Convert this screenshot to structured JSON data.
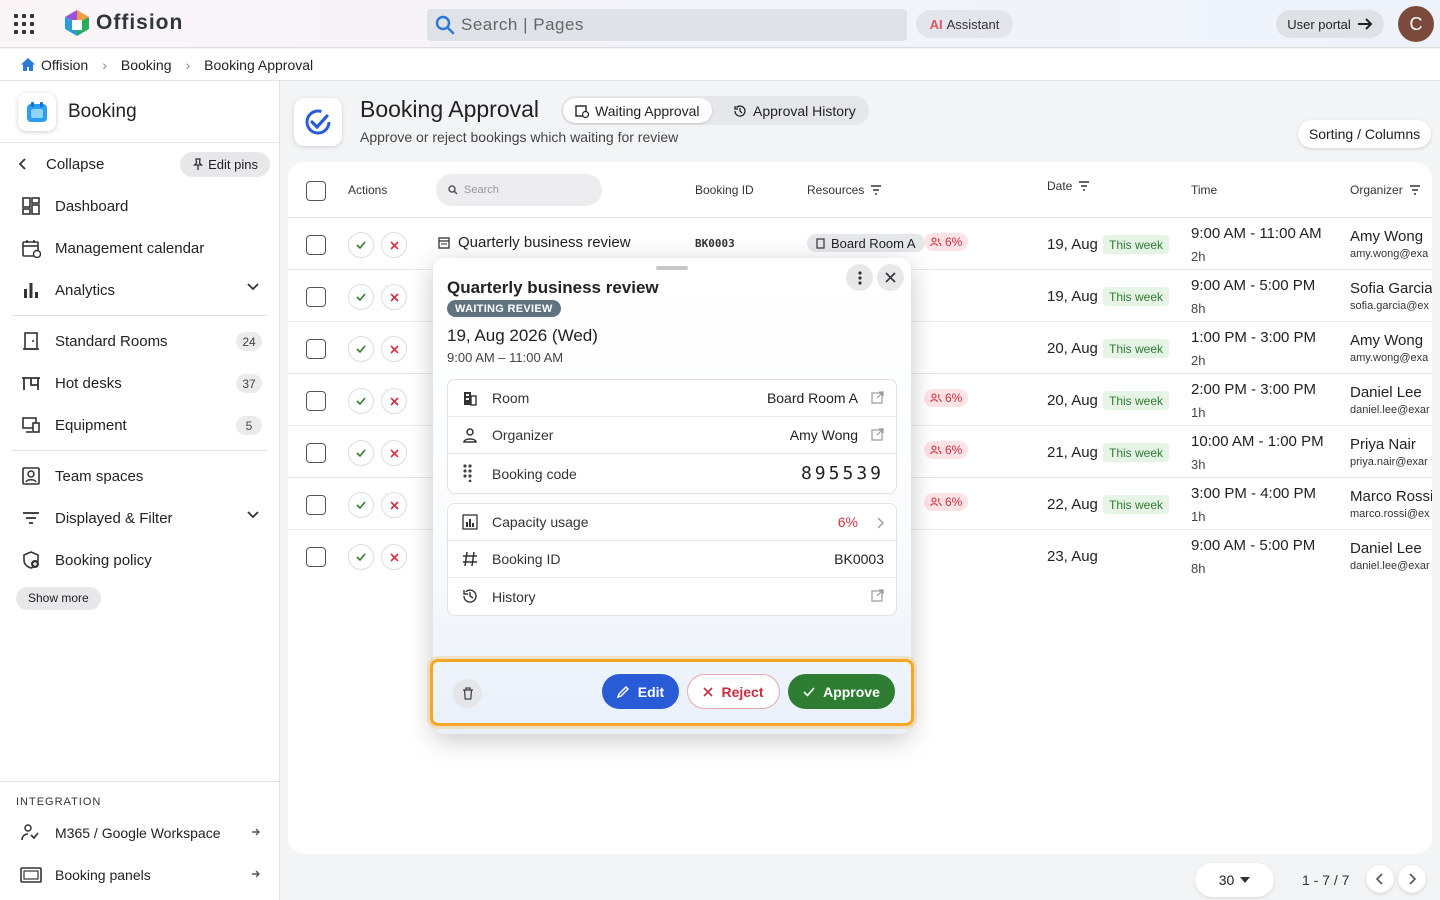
{
  "app": {
    "name": "Offision",
    "search_placeholder": "Search | Pages",
    "ai_badge": "AI",
    "assistant_label": "Assistant",
    "user_portal_label": "User portal",
    "avatar_initial": "C"
  },
  "breadcrumb": [
    "Offision",
    "Booking",
    "Booking Approval"
  ],
  "sidebar": {
    "title": "Booking",
    "collapse_label": "Collapse",
    "edit_pins_label": "Edit pins",
    "items": [
      {
        "label": "Dashboard",
        "icon": "dashboard-icon"
      },
      {
        "label": "Management calendar",
        "icon": "calendar-icon"
      },
      {
        "label": "Analytics",
        "icon": "bar-chart-icon"
      },
      {
        "label": "Standard Rooms",
        "icon": "door-icon",
        "count": "24"
      },
      {
        "label": "Hot desks",
        "icon": "desk-icon",
        "count": "37"
      },
      {
        "label": "Equipment",
        "icon": "monitor-icon",
        "count": "5"
      },
      {
        "label": "Team spaces",
        "icon": "team-icon"
      },
      {
        "label": "Displayed & Filter",
        "icon": "filter-icon"
      },
      {
        "label": "Booking policy",
        "icon": "policy-icon"
      }
    ],
    "show_more_label": "Show more",
    "integration_title": "INTEGRATION",
    "integrations": [
      {
        "label": "M365 / Google Workspace",
        "icon": "workspace-icon"
      },
      {
        "label": "Booking panels",
        "icon": "panel-icon"
      }
    ]
  },
  "page": {
    "title": "Booking Approval",
    "subtitle": "Approve or reject bookings which waiting for review",
    "tabs": [
      {
        "label": "Waiting Approval",
        "active": true
      },
      {
        "label": "Approval History",
        "active": false
      }
    ],
    "sorting_label": "Sorting / Columns"
  },
  "table": {
    "columns": {
      "actions": "Actions",
      "search_placeholder": "Search",
      "booking_id": "Booking ID",
      "resources": "Resources",
      "date": "Date",
      "time": "Time",
      "organizer": "Organizer"
    },
    "rows": [
      {
        "title": "Quarterly business review",
        "booking_id": "BK0003",
        "resource": "Board Room A",
        "capacity": "6%",
        "date": "19, Aug",
        "week": "This week",
        "time": "9:00 AM  -  11:00 AM",
        "duration": "2h",
        "organizer": "Amy Wong",
        "email": "amy.wong@exa"
      },
      {
        "date": "19, Aug",
        "week": "This week",
        "time": "9:00 AM  -  5:00 PM",
        "duration": "8h",
        "organizer": "Sofia Garcia",
        "email": "sofia.garcia@ex"
      },
      {
        "date": "20, Aug",
        "week": "This week",
        "time": "1:00 PM  -  3:00 PM",
        "duration": "2h",
        "organizer": "Amy Wong",
        "email": "amy.wong@exa"
      },
      {
        "capacity": "6%",
        "date": "20, Aug",
        "week": "This week",
        "time": "2:00 PM  -  3:00 PM",
        "duration": "1h",
        "organizer": "Daniel Lee",
        "email": "daniel.lee@exar"
      },
      {
        "capacity": "6%",
        "date": "21, Aug",
        "week": "This week",
        "time": "10:00 AM  -  1:00 PM",
        "duration": "3h",
        "organizer": "Priya Nair",
        "email": "priya.nair@exar"
      },
      {
        "capacity": "6%",
        "date": "22, Aug",
        "week": "This week",
        "time": "3:00 PM  -  4:00 PM",
        "duration": "1h",
        "organizer": "Marco Rossi",
        "email": "marco.rossi@ex"
      },
      {
        "date": "23, Aug",
        "time": "9:00 AM  -  5:00 PM",
        "duration": "8h",
        "organizer": "Daniel Lee",
        "email": "daniel.lee@exar"
      }
    ]
  },
  "pagination": {
    "per_page": "30",
    "range": "1 - 7 / 7"
  },
  "popup": {
    "title": "Quarterly business review",
    "status": "WAITING REVIEW",
    "date": "19, Aug 2026 (Wed)",
    "time": "9:00 AM – 11:00 AM",
    "details": {
      "room_label": "Room",
      "room_value": "Board Room A",
      "organizer_label": "Organizer",
      "organizer_value": "Amy Wong",
      "code_label": "Booking code",
      "code_value": "895539",
      "capacity_label": "Capacity usage",
      "capacity_value": "6%",
      "id_label": "Booking ID",
      "id_value": "BK0003",
      "history_label": "History"
    },
    "edit_label": "Edit",
    "reject_label": "Reject",
    "approve_label": "Approve"
  },
  "colors": {
    "accent": "#2a5bd7",
    "approve": "#2e7d32",
    "reject": "#c62f3f",
    "highlight": "#f5a623"
  }
}
